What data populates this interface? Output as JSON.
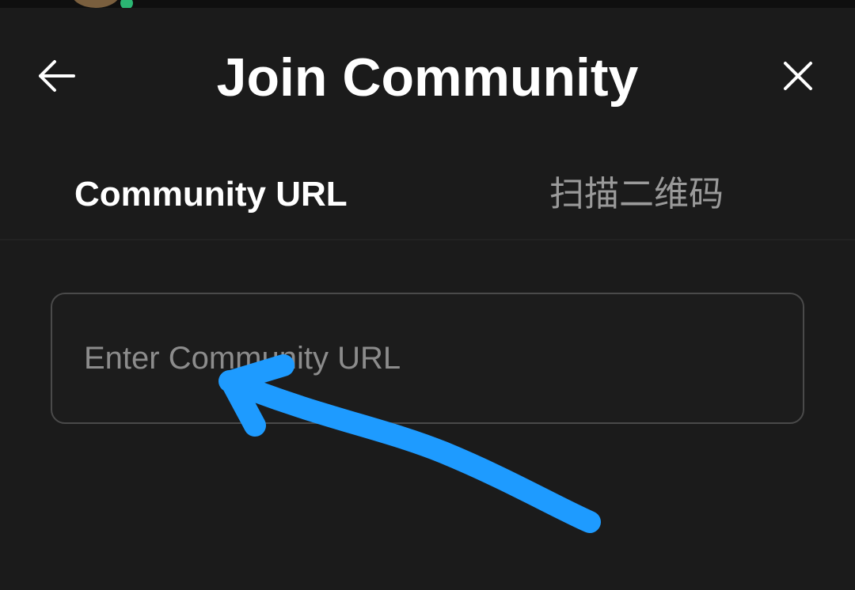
{
  "header": {
    "title": "Join Community",
    "back_icon": "arrow-left-icon",
    "close_icon": "close-icon"
  },
  "tabs": [
    {
      "label": "Community URL",
      "active": true
    },
    {
      "label": "扫描二维码",
      "active": false
    }
  ],
  "url_input": {
    "value": "",
    "placeholder": "Enter Community URL"
  },
  "colors": {
    "background": "#1b1b1b",
    "text_primary": "#ffffff",
    "text_secondary": "#9a9a9a",
    "input_border": "#4a4a4a",
    "annotation_arrow": "#1e9bff",
    "online_status": "#2bb673"
  },
  "icons": {
    "back": "arrow-left-icon",
    "close": "close-icon",
    "annotation": "hand-drawn-arrow-icon"
  }
}
